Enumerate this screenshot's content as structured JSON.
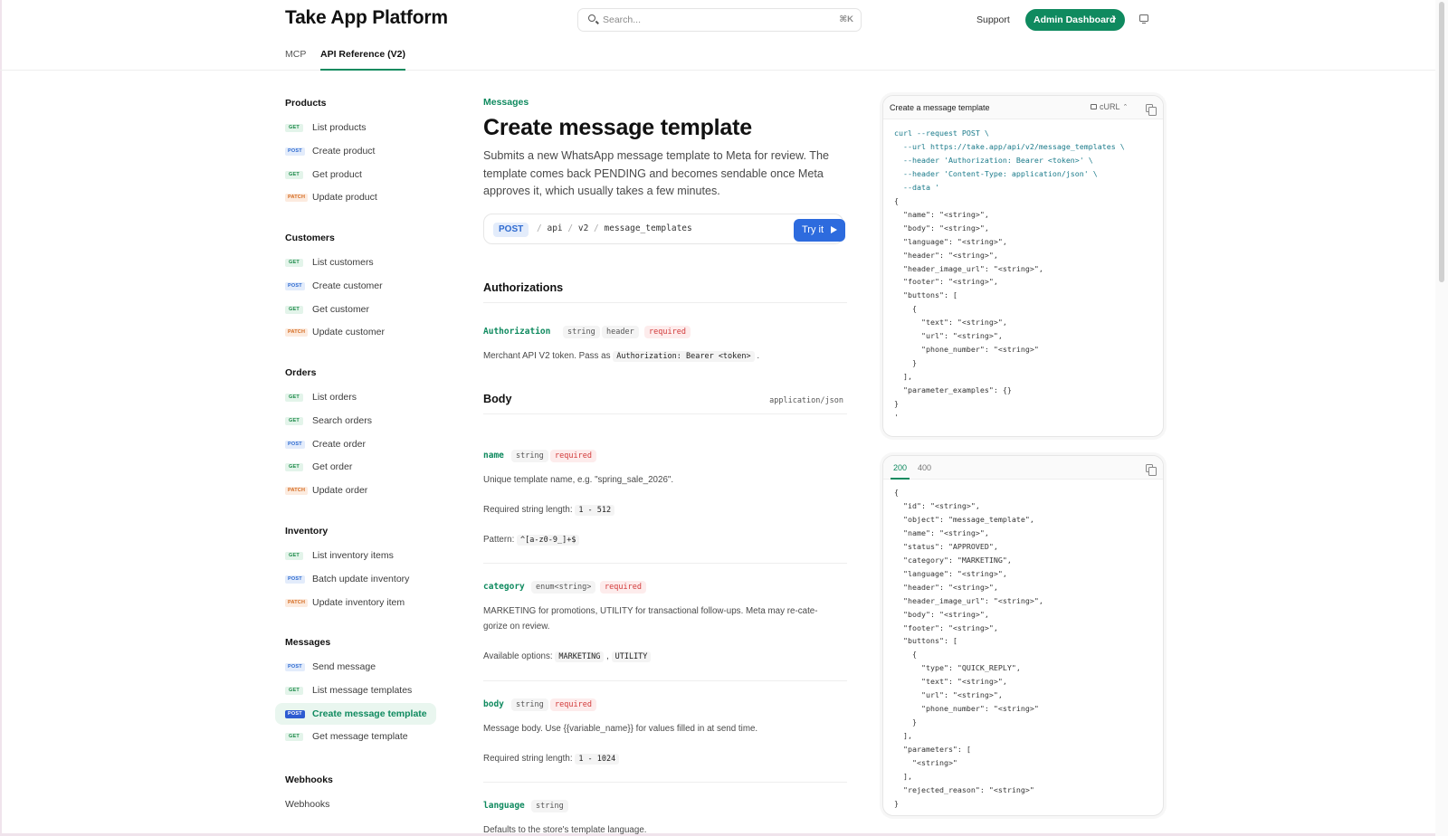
{
  "header": {
    "brand": "Take App Platform",
    "search_placeholder": "Search...",
    "search_shortcut": "⌘K",
    "support": "Support",
    "admin_button": "Admin Dashboard",
    "tabs": [
      {
        "label": "MCP",
        "active": false
      },
      {
        "label": "API Reference (V2)",
        "active": true
      }
    ]
  },
  "sidebar": {
    "groups": [
      {
        "title": "Products",
        "items": [
          {
            "method": "GET",
            "label": "List products"
          },
          {
            "method": "POST",
            "label": "Create product"
          },
          {
            "method": "GET",
            "label": "Get product"
          },
          {
            "method": "PATCH",
            "label": "Update product"
          }
        ]
      },
      {
        "title": "Customers",
        "items": [
          {
            "method": "GET",
            "label": "List customers"
          },
          {
            "method": "POST",
            "label": "Create customer"
          },
          {
            "method": "GET",
            "label": "Get customer"
          },
          {
            "method": "PATCH",
            "label": "Update customer"
          }
        ]
      },
      {
        "title": "Orders",
        "items": [
          {
            "method": "GET",
            "label": "List orders"
          },
          {
            "method": "GET",
            "label": "Search orders"
          },
          {
            "method": "POST",
            "label": "Create order"
          },
          {
            "method": "GET",
            "label": "Get order"
          },
          {
            "method": "PATCH",
            "label": "Update order"
          }
        ]
      },
      {
        "title": "Inventory",
        "items": [
          {
            "method": "GET",
            "label": "List inventory items"
          },
          {
            "method": "POST",
            "label": "Batch update inventory"
          },
          {
            "method": "PATCH",
            "label": "Update inventory item"
          }
        ]
      },
      {
        "title": "Messages",
        "items": [
          {
            "method": "POST",
            "label": "Send message"
          },
          {
            "method": "GET",
            "label": "List message templates"
          },
          {
            "method": "POST",
            "label": "Create message template",
            "active": true
          },
          {
            "method": "GET",
            "label": "Get message template"
          }
        ]
      },
      {
        "title": "Webhooks",
        "items": [
          {
            "method": "",
            "label": "Webhooks"
          }
        ]
      }
    ]
  },
  "main": {
    "breadcrumb": "Messages",
    "title": "Create message template",
    "description": "Submits a new WhatsApp message template to Meta for review. The template comes back PENDING and becomes sendable once Meta approves it, which usually takes a few minutes.",
    "endpoint": {
      "method": "POST",
      "path": [
        "api",
        "v2",
        "message_templates"
      ],
      "try_label": "Try it"
    },
    "authorizations": {
      "title": "Authorizations",
      "name": "Authorization",
      "type": "string",
      "location": "header",
      "required": "required",
      "text_before": "Merchant API V2 token. Pass as",
      "code": "Authorization: Bearer <token>",
      "text_after": "."
    },
    "body": {
      "title": "Body",
      "content_type": "application/json",
      "params": {
        "name": {
          "name": "name",
          "type": "string",
          "required": "required",
          "desc": "Unique template name, e.g. \"spring_sale_2026\".",
          "length_label": "Required string length:",
          "length": "1 - 512",
          "pattern_label": "Pattern:",
          "pattern": "^[a-z0-9_]+$"
        },
        "category": {
          "name": "category",
          "type": "enum<string>",
          "required": "required",
          "desc_1": "MARKETING for promotions, UTILITY for transactional follow-ups. Meta may re-cate-",
          "desc_2": "gorize on review.",
          "options_label": "Available options:",
          "option_1": "MARKETING",
          "option_2": "UTILITY"
        },
        "body": {
          "name": "body",
          "type": "string",
          "required": "required",
          "desc": "Message body. Use {{variable_name}} for values filled in at send time.",
          "length_label": "Required string length:",
          "length": "1 - 1024"
        },
        "language": {
          "name": "language",
          "type": "string",
          "desc": "Defaults to the store's template language."
        }
      }
    }
  },
  "request_panel": {
    "title": "Create a message template",
    "language": "cURL",
    "code": "curl --request POST \\\n  --url https://take.app/api/v2/message_templates \\\n  --header 'Authorization: Bearer <token>' \\\n  --header 'Content-Type: application/json' \\\n  --data '\n{\n  \"name\": \"<string>\",\n  \"body\": \"<string>\",\n  \"language\": \"<string>\",\n  \"header\": \"<string>\",\n  \"header_image_url\": \"<string>\",\n  \"footer\": \"<string>\",\n  \"buttons\": [\n    {\n      \"text\": \"<string>\",\n      \"url\": \"<string>\",\n      \"phone_number\": \"<string>\"\n    }\n  ],\n  \"parameter_examples\": {}\n}\n'"
  },
  "response_panel": {
    "tabs": [
      "200",
      "400"
    ],
    "code": "{\n  \"id\": \"<string>\",\n  \"object\": \"message_template\",\n  \"name\": \"<string>\",\n  \"status\": \"APPROVED\",\n  \"category\": \"MARKETING\",\n  \"language\": \"<string>\",\n  \"header\": \"<string>\",\n  \"header_image_url\": \"<string>\",\n  \"body\": \"<string>\",\n  \"footer\": \"<string>\",\n  \"buttons\": [\n    {\n      \"type\": \"QUICK_REPLY\",\n      \"text\": \"<string>\",\n      \"url\": \"<string>\",\n      \"phone_number\": \"<string>\"\n    }\n  ],\n  \"parameters\": [\n    \"<string>\"\n  ],\n  \"rejected_reason\": \"<string>\"\n}"
  },
  "colors": {
    "accent": "#0f8a5f",
    "post": "#2f6bd0",
    "get": "#1e8a4a",
    "patch": "#d46a1f",
    "required": "#d23a3a"
  }
}
